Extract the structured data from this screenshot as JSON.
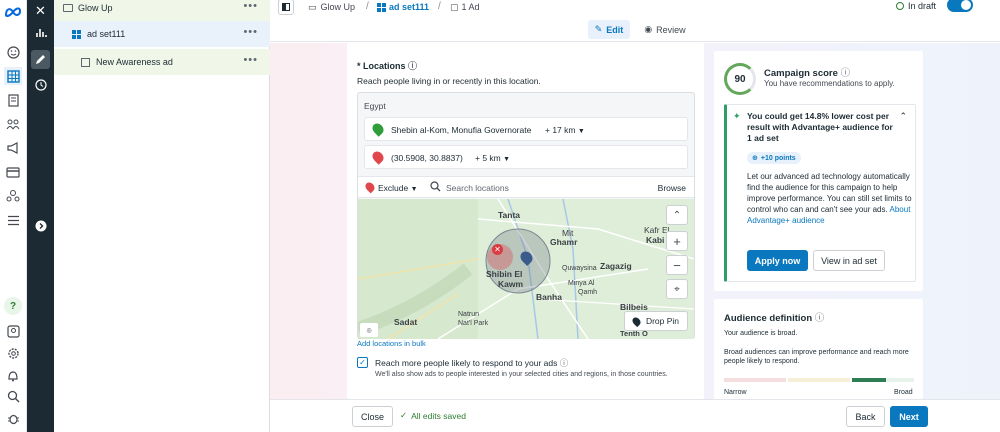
{
  "rail": {
    "icons": [
      "meta-logo-icon",
      "smiley-icon",
      "grid-table-icon",
      "ads-book-icon",
      "people-icon",
      "megaphone-icon",
      "card-icon",
      "audience-icon",
      "menu-icon",
      "help-icon",
      "inbox-icon",
      "gear-icon",
      "bell-icon",
      "search-icon",
      "bug-icon"
    ]
  },
  "tree": {
    "campaign": "Glow Up",
    "adset": "ad set111",
    "ad": "New Awareness ad"
  },
  "header": {
    "crumbs": [
      "Glow Up",
      "ad set111",
      "1 Ad"
    ],
    "status": "In draft",
    "edit_label": "Edit",
    "review_label": "Review"
  },
  "locations": {
    "title": "* Locations",
    "description": "Reach people living in or recently in this location.",
    "country": "Egypt",
    "entries": [
      {
        "name": "Shebin al-Kom, Monufia Governorate",
        "radius": "+ 17 km"
      },
      {
        "name": "(30.5908, 30.8837)",
        "radius": "+ 5 km"
      }
    ],
    "exclude_label": "Exclude",
    "search_placeholder": "Search locations",
    "browse_label": "Browse",
    "map_labels": [
      "Tanta",
      "Mit",
      "Ghamr",
      "Kafr El",
      "Kabi",
      "Shibin El",
      "Kawm",
      "Quwaysina",
      "Zagazig",
      "Minya Al",
      "Qamh",
      "Banha",
      "Bilbeis",
      "Sadat",
      "Natrun",
      "Nat'l Park",
      "Tenth O"
    ],
    "drop_pin_label": "Drop Pin",
    "bulk_link": "Add locations in bulk",
    "advantage_label": "Reach more people likely to respond to your ads",
    "advantage_desc": "We'll also show ads to people interested in your selected cities and regions, in those countries."
  },
  "campaign_score": {
    "score": "90",
    "title": "Campaign score",
    "subtitle": "You have recommendations to apply.",
    "rec_title": "You could get 14.8% lower cost per result with Advantage+ audience for 1 ad set",
    "points": "+10 points",
    "rec_body": "Let our advanced ad technology automatically find the audience for this campaign to help improve performance. You can still set limits to control who can and can't see your ads.",
    "rec_link": "About Advantage+ audience",
    "apply_label": "Apply now",
    "view_label": "View in ad set"
  },
  "audience": {
    "title": "Audience definition",
    "broad_text": "Your audience is broad.",
    "desc": "Broad audiences can improve performance and reach more people likely to respond.",
    "left_label": "Narrow",
    "right_label": "Broad",
    "level": 0.85
  },
  "footer": {
    "close_label": "Close",
    "saved_text": "All edits saved",
    "back_label": "Back",
    "next_label": "Next"
  }
}
